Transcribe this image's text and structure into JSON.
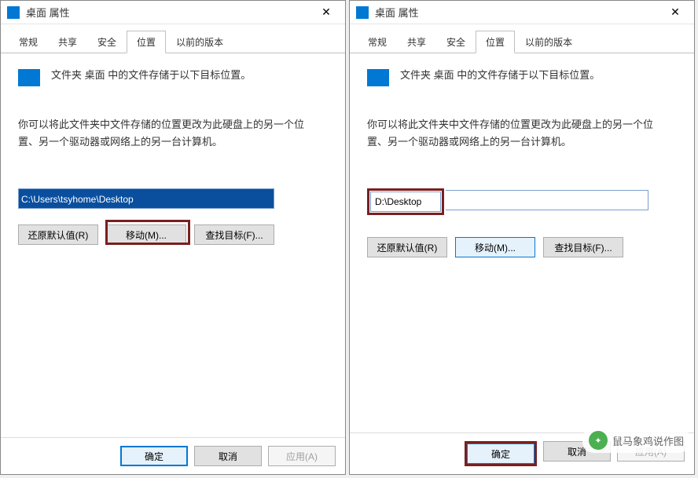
{
  "left": {
    "title": "桌面 属性",
    "tabs": [
      "常规",
      "共享",
      "安全",
      "位置",
      "以前的版本"
    ],
    "active_tab": 3,
    "info": "文件夹 桌面 中的文件存储于以下目标位置。",
    "description": "你可以将此文件夹中文件存储的位置更改为此硬盘上的另一个位置、另一个驱动器或网络上的另一台计算机。",
    "path": "C:\\Users\\tsyhome\\Desktop",
    "buttons": {
      "restore": "还原默认值(R)",
      "move": "移动(M)...",
      "find": "查找目标(F)..."
    },
    "footer": {
      "ok": "确定",
      "cancel": "取消",
      "apply": "应用(A)"
    }
  },
  "right": {
    "title": "桌面 属性",
    "tabs": [
      "常规",
      "共享",
      "安全",
      "位置",
      "以前的版本"
    ],
    "active_tab": 3,
    "info": "文件夹 桌面 中的文件存储于以下目标位置。",
    "description": "你可以将此文件夹中文件存储的位置更改为此硬盘上的另一个位置、另一个驱动器或网络上的另一台计算机。",
    "path": "D:\\Desktop",
    "buttons": {
      "restore": "还原默认值(R)",
      "move": "移动(M)...",
      "find": "查找目标(F)..."
    },
    "footer": {
      "ok": "确定",
      "cancel": "取消",
      "apply": "应用(A)"
    }
  },
  "watermark": "鼠马象鸡说作图"
}
